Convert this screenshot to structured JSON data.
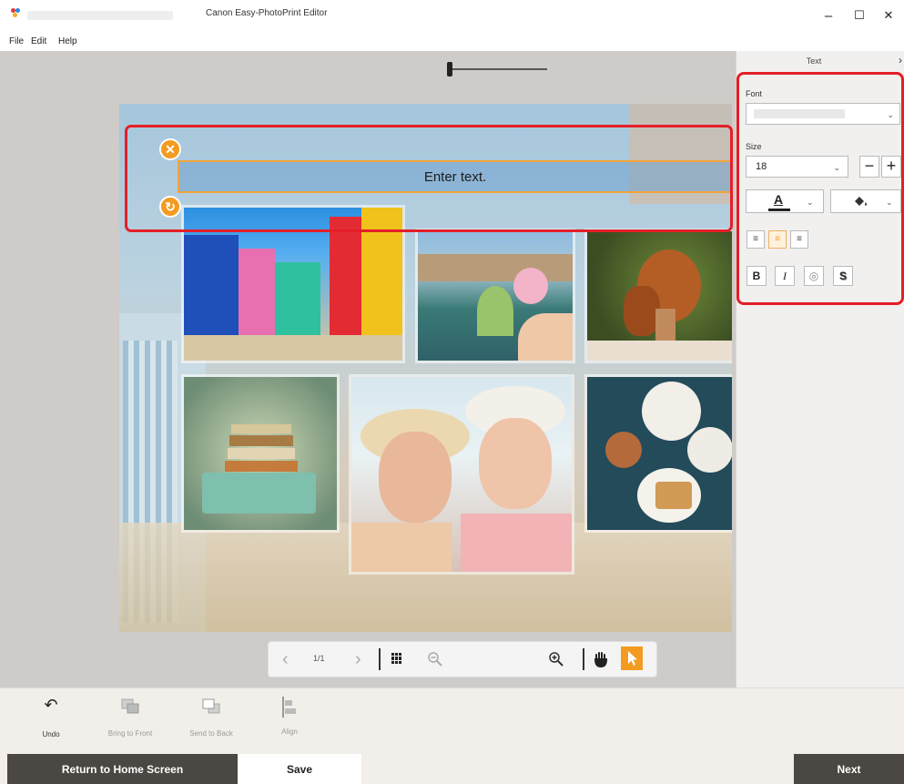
{
  "window": {
    "title": "Canon Easy-PhotoPrint Editor",
    "controls": {
      "minimize": "–",
      "maximize": "☐",
      "close": "✕"
    }
  },
  "menubar": {
    "items": [
      "File",
      "Edit",
      "Help"
    ]
  },
  "canvas": {
    "textbox_placeholder": "Enter text.",
    "handles": {
      "delete": "✕",
      "rotate": "↻"
    }
  },
  "zoom_toolbar": {
    "prev": "‹",
    "page_indicator": "1/1",
    "next": "›",
    "grid_icon": "grid-icon",
    "zoom_out_icon": "zoom-out-icon",
    "zoom_in_icon": "zoom-in-icon",
    "hand_icon": "hand-icon",
    "pointer_icon": "pointer-icon",
    "zoom_level": 0.05
  },
  "text_panel": {
    "title": "Text",
    "close": "›",
    "font_label": "Font",
    "font_value": "",
    "size_label": "Size",
    "size_value": "18",
    "size_decrease": "−",
    "size_increase": "+",
    "text_color_glyph": "A",
    "align_left": "≡",
    "align_center": "≡",
    "align_right": "≡",
    "bold": "B",
    "italic": "I",
    "outline": "◎",
    "shadow": "S"
  },
  "edit_toolbar": {
    "undo": "Undo",
    "bring_to_front": "Bring to Front",
    "send_to_back": "Send to Back",
    "align": "Align"
  },
  "footer": {
    "return_home": "Return to Home Screen",
    "save": "Save",
    "next": "Next"
  },
  "colors": {
    "accent": "#f39b20",
    "selection_highlight": "#e41f28",
    "footer_dark": "#4b4743",
    "panel_bg": "#f2f0ee"
  }
}
